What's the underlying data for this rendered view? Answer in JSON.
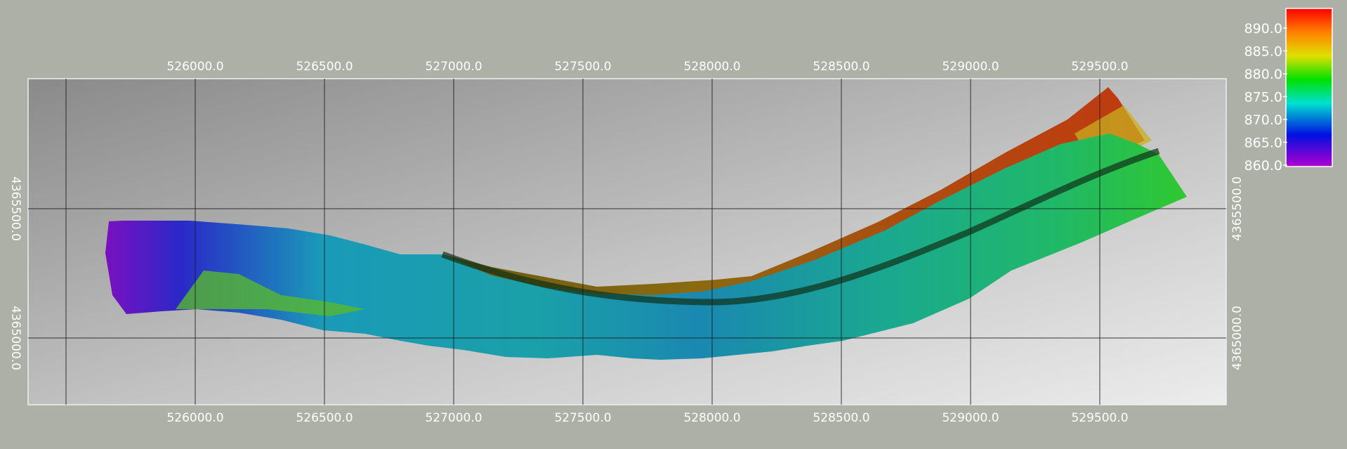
{
  "map": {
    "x_ticks": [
      "526000.0",
      "526500.0",
      "527000.0",
      "527500.0",
      "528000.0",
      "528500.0",
      "529000.0",
      "529500.0"
    ],
    "y_ticks": [
      "4365500.0",
      "4365000.0"
    ]
  },
  "legend": {
    "labels": [
      "890.0",
      "885.0",
      "880.0",
      "875.0",
      "870.0",
      "865.0",
      "860.0"
    ],
    "colors": [
      "#ff1010",
      "#ff8a10",
      "#e8e010",
      "#10d810",
      "#10d8d0",
      "#1020d8",
      "#a010d0"
    ]
  }
}
